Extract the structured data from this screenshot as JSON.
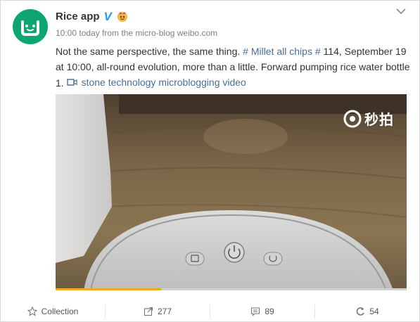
{
  "post": {
    "author": "Rice app",
    "verified_mark": "V",
    "meta": "10:00 today from the micro-blog weibo.com",
    "text_before": "Not the same perspective, the same thing. ",
    "topic": "# Millet all chips #",
    "text_after": " 114, September 19 at 10:00, all-round evolution, more than a little. Forward pumping rice water bottle 1.  ",
    "video_link": "stone technology microblogging video"
  },
  "video": {
    "watermark": "秒拍",
    "progress": 0.3
  },
  "footer": {
    "collection_label": "Collection",
    "repost_count": "277",
    "comment_count": "89",
    "like_count": "54"
  },
  "colors": {
    "brand": "#0fa573",
    "link": "#4a6d95",
    "verified": "#1d9bf0",
    "progress": "#f5a623"
  },
  "icons": [
    "mi-logo-icon",
    "crown-badge-icon",
    "chevron-down-icon",
    "video-icon",
    "star-icon",
    "repost-icon",
    "comment-icon",
    "like-icon",
    "miaopai-logo-icon"
  ]
}
